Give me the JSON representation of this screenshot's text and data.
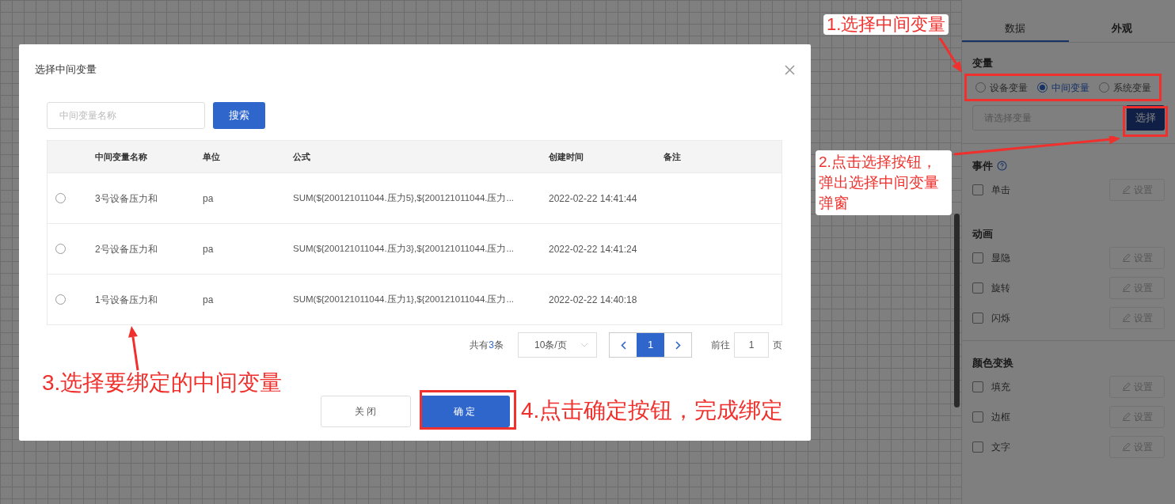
{
  "panel": {
    "tabs": [
      {
        "label": "数据",
        "selected": true
      },
      {
        "label": "外观",
        "selected": false
      }
    ],
    "variable": {
      "title": "变量",
      "options": [
        {
          "label": "设备变量",
          "selected": false
        },
        {
          "label": "中间变量",
          "selected": true
        },
        {
          "label": "系统变量",
          "selected": false
        }
      ],
      "placeholder": "请选择变量",
      "button": "选择"
    },
    "sections": [
      {
        "title": "事件",
        "help": true,
        "items": [
          {
            "label": "单击",
            "checked": false,
            "button": "设置",
            "disabled": true
          }
        ]
      },
      {
        "title": "动画",
        "help": false,
        "items": [
          {
            "label": "显隐",
            "checked": false,
            "button": "设置",
            "disabled": true
          },
          {
            "label": "旋转",
            "checked": false,
            "button": "设置",
            "disabled": true
          },
          {
            "label": "闪烁",
            "checked": false,
            "button": "设置",
            "disabled": true
          }
        ]
      },
      {
        "title": "颜色变换",
        "help": false,
        "items": [
          {
            "label": "填充",
            "checked": false,
            "button": "设置",
            "disabled": true
          },
          {
            "label": "边框",
            "checked": false,
            "button": "设置",
            "disabled": true
          },
          {
            "label": "文字",
            "checked": false,
            "button": "设置",
            "disabled": true
          }
        ]
      }
    ]
  },
  "dialog": {
    "title": "选择中间变量",
    "search": {
      "placeholder": "中间变量名称",
      "button": "搜索"
    },
    "table": {
      "columns": [
        "中间变量名称",
        "单位",
        "公式",
        "创建时间",
        "备注"
      ],
      "rows": [
        {
          "selected": false,
          "cells": [
            "3号设备压力和",
            "pa",
            "SUM(${200121011044.压力5},${200121011044.压力...",
            "2022-02-22 14:41:44"
          ]
        },
        {
          "selected": false,
          "cells": [
            "2号设备压力和",
            "pa",
            "SUM(${200121011044.压力3},${200121011044.压力...",
            "2022-02-22 14:41:24"
          ]
        },
        {
          "selected": false,
          "cells": [
            "1号设备压力和",
            "pa",
            "SUM(${200121011044.压力1},${200121011044.压力...",
            "2022-02-22 14:40:18"
          ]
        }
      ]
    },
    "pagination": {
      "total_prefix": "共有",
      "total": "3",
      "total_suffix": "条",
      "page_size": "10条/页",
      "pages": [
        {
          "label": "1",
          "selected": true
        }
      ],
      "goto_label": "前往",
      "goto_value": "1",
      "goto_suffix": "页"
    },
    "buttons": [
      {
        "label": "关 闭",
        "kind": "plain"
      },
      {
        "label": "确 定",
        "kind": "primary"
      }
    ]
  },
  "annotations": [
    "1.选择中间变量",
    "2.点击选择按钮，弹出选择中间变量弹窗",
    "3.选择要绑定的中间变量",
    "4.点击确定按钮，完成绑定"
  ]
}
